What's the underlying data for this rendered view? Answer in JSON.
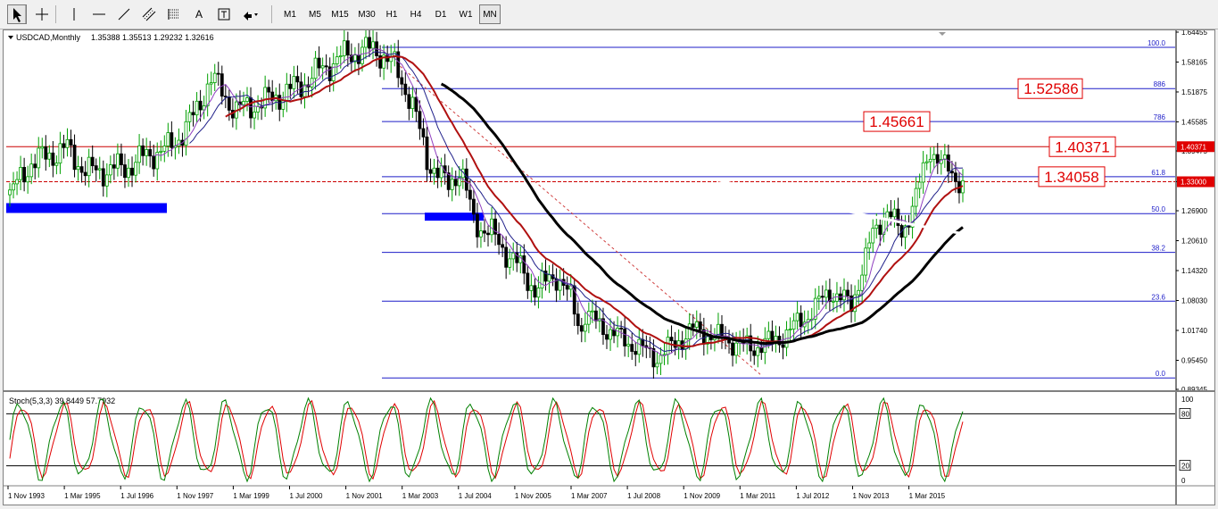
{
  "toolbar": {
    "tools": [
      {
        "name": "cursor-tool",
        "icon": "cursor-arrow-icon",
        "active": true
      },
      {
        "name": "crosshair-tool",
        "icon": "crosshair-icon",
        "active": false
      },
      {
        "name": "vertical-line-tool",
        "icon": "vertical-line-icon",
        "active": false
      },
      {
        "name": "horizontal-line-tool",
        "icon": "horizontal-line-icon",
        "active": false
      },
      {
        "name": "trendline-tool",
        "icon": "trendline-icon",
        "active": false
      },
      {
        "name": "equidistant-channel-tool",
        "icon": "channel-icon",
        "active": false
      },
      {
        "name": "fibonacci-tool",
        "icon": "fibonacci-icon",
        "active": false
      },
      {
        "name": "text-tool",
        "icon": "text-a-icon",
        "active": false,
        "label": "A"
      },
      {
        "name": "text-label-tool",
        "icon": "text-label-icon",
        "active": false
      },
      {
        "name": "arrows-tool",
        "icon": "arrows-dropdown-icon",
        "active": false
      }
    ],
    "timeframes": [
      "M1",
      "M5",
      "M15",
      "M30",
      "H1",
      "H4",
      "D1",
      "W1",
      "MN"
    ],
    "active_timeframe": "MN"
  },
  "chart_data": [
    {
      "type": "candlestick",
      "symbol_header": "USDCAD,Monthly",
      "ohlc_header": "1.35388 1.35513 1.29232 1.32616",
      "ylim": [
        0.8935,
        1.6445
      ],
      "price_ticks": [
        "1.64455",
        "1.58165",
        "1.51875",
        "1.45585",
        "1.39475",
        "1.33000",
        "1.26900",
        "1.20610",
        "1.14320",
        "1.08030",
        "1.01740",
        "0.95450",
        "0.89345"
      ],
      "time_ticks": [
        "1 Nov 1993",
        "1 Mar 1995",
        "1 Jul 1996",
        "1 Nov 1997",
        "1 Mar 1999",
        "1 Jul 2000",
        "1 Nov 2001",
        "1 Mar 2003",
        "1 Jul 2004",
        "1 Nov 2005",
        "1 Mar 2007",
        "1 Jul 2008",
        "1 Nov 2009",
        "1 Mar 2011",
        "1 Jul 2012",
        "1 Nov 2013",
        "1 Mar 2015"
      ],
      "fib_levels": [
        {
          "label": "100.0",
          "price": 1.6125
        },
        {
          "label": "886",
          "price": 1.5258
        },
        {
          "label": "786",
          "price": 1.4566
        },
        {
          "label": "61.8",
          "price": 1.3406
        },
        {
          "label": "50.0",
          "price": 1.263
        },
        {
          "label": "38.2",
          "price": 1.1815
        },
        {
          "label": "23.6",
          "price": 1.0788
        },
        {
          "label": "0.0",
          "price": 0.9175
        }
      ],
      "horizontal_lines": [
        {
          "price": 1.4037,
          "style": "solid",
          "color": "#cc0000",
          "label": "1.40371"
        },
        {
          "price": 1.33,
          "style": "dashed",
          "color": "#cc0000",
          "label": "1.33000"
        }
      ],
      "annotations": [
        {
          "text": "1.52586",
          "price": 1.5258
        },
        {
          "text": "1.45661",
          "price": 1.4566
        },
        {
          "text": "1.40371",
          "price": 1.4037
        },
        {
          "text": "1.34058",
          "price": 1.3406
        }
      ],
      "colors": {
        "bull": "#00a000",
        "bear": "#000000",
        "fib": "#1d1dc8",
        "ma_black": "#000000",
        "ma_red": "#b01010",
        "ma_purple": "#9040c0",
        "ma_navy": "#20208a",
        "ma_white": "#ffffff",
        "zone": "#0000ff",
        "accent_red": "#e00000"
      }
    },
    {
      "type": "line",
      "indicator_header": "Stoch(5,3,3) 39.8449 57.7932",
      "ylim": [
        0,
        100
      ],
      "levels": [
        {
          "label": "80",
          "value": 80
        },
        {
          "label": "20",
          "value": 20
        }
      ],
      "y_ticks": [
        {
          "label": "100",
          "value": 100
        },
        {
          "label": "0",
          "value": 0
        }
      ],
      "series": [
        {
          "role": "main",
          "color": "#008000"
        },
        {
          "role": "signal",
          "color": "#e00000"
        }
      ],
      "last_values": [
        39.8449,
        57.7932
      ]
    }
  ]
}
